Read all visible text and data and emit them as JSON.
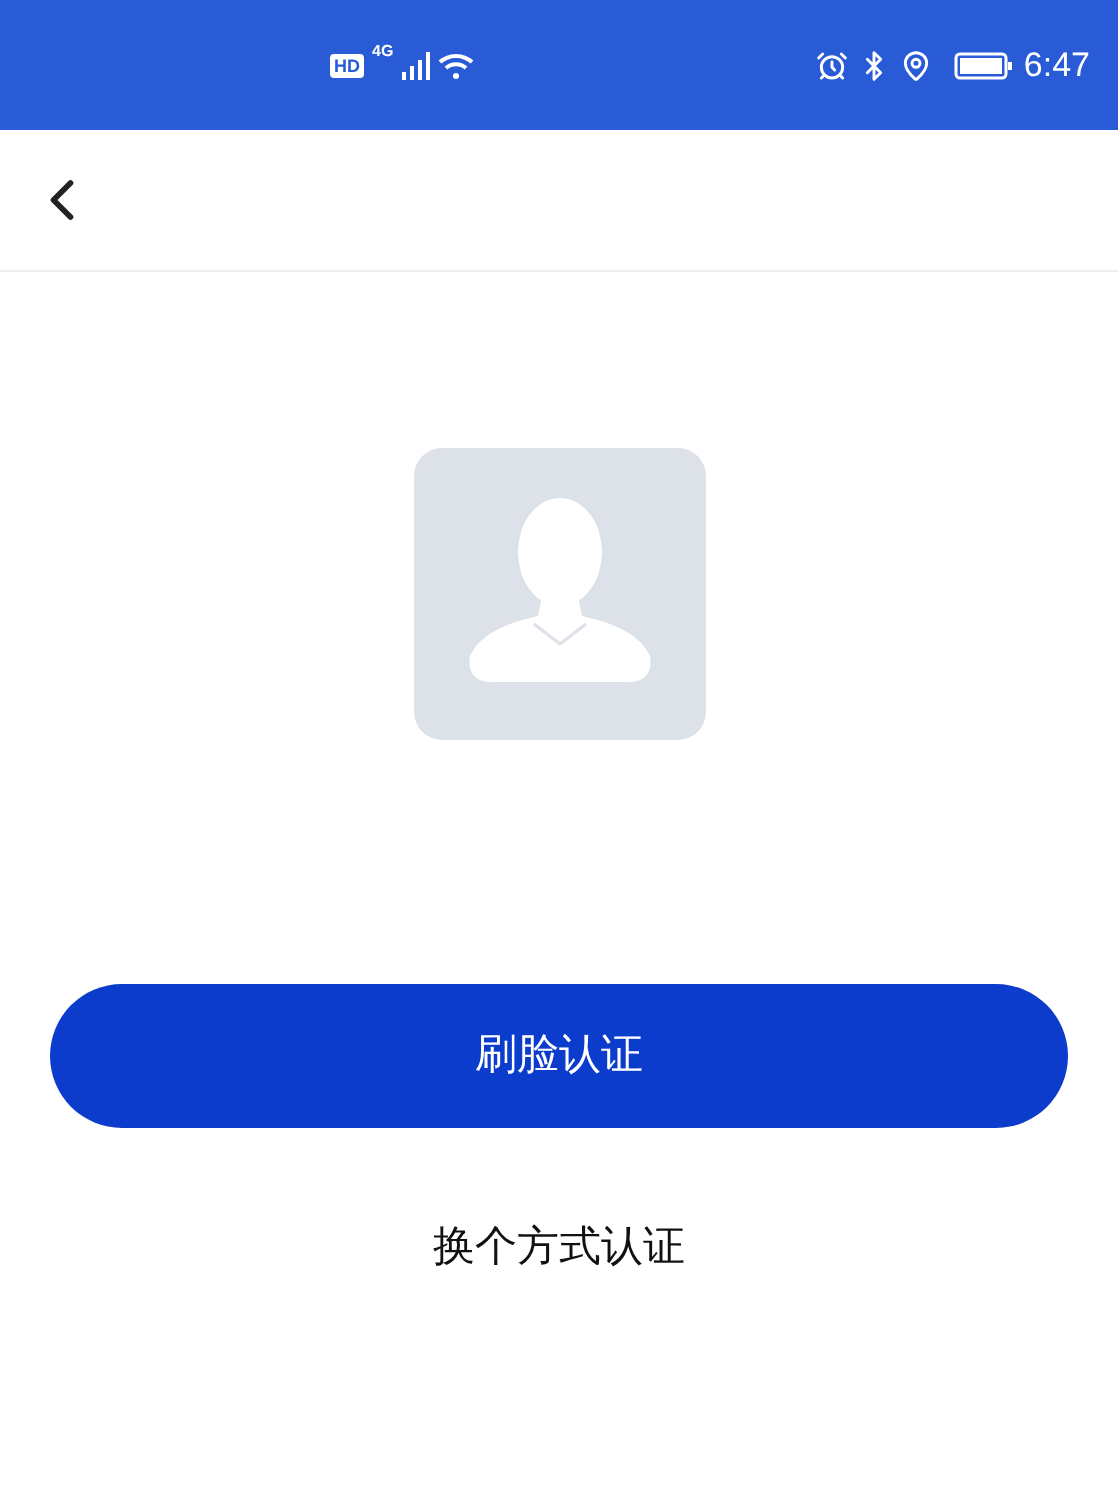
{
  "status_bar": {
    "hd": "HD",
    "network": "4G",
    "time": "6:47"
  },
  "primary_button": {
    "label": "刷脸认证"
  },
  "alternate_link": {
    "label": "换个方式认证"
  }
}
